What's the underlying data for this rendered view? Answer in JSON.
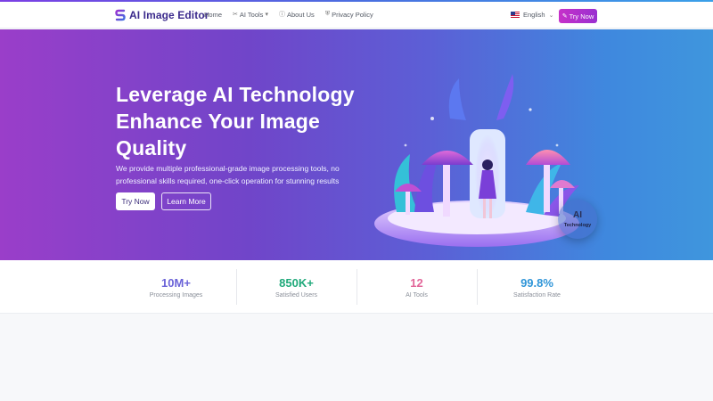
{
  "nav": {
    "brand": "AI Image Editor",
    "links": [
      {
        "label": "Home",
        "icon": ""
      },
      {
        "label": "AI Tools",
        "icon": "magic-wand-icon"
      },
      {
        "label": "About Us",
        "icon": "info-icon"
      },
      {
        "label": "Privacy Policy",
        "icon": "shield-icon"
      }
    ],
    "language": "English",
    "try_now": "Try Now"
  },
  "hero": {
    "title_lines": [
      "Leverage AI Technology",
      "Enhance Your Image",
      "Quality"
    ],
    "subtitle": "We provide multiple professional-grade image processing tools, no professional skills required, one-click operation for stunning results",
    "primary_button": "Try Now",
    "secondary_button": "Learn More",
    "badge_main": "AI",
    "badge_sub": "Technology"
  },
  "stats": [
    {
      "value": "10M+",
      "label": "Processing Images",
      "color": "#6b63d8"
    },
    {
      "value": "850K+",
      "label": "Satisfied Users",
      "color": "#1fa97a"
    },
    {
      "value": "12",
      "label": "AI Tools",
      "color": "#e2679a"
    },
    {
      "value": "99.8%",
      "label": "Satisfaction Rate",
      "color": "#2f95d8"
    }
  ],
  "colors": {
    "brand": "#3b2a8c",
    "accent": "#c631c9",
    "hero_start": "#9a3ec9",
    "hero_end": "#3f96dd"
  }
}
